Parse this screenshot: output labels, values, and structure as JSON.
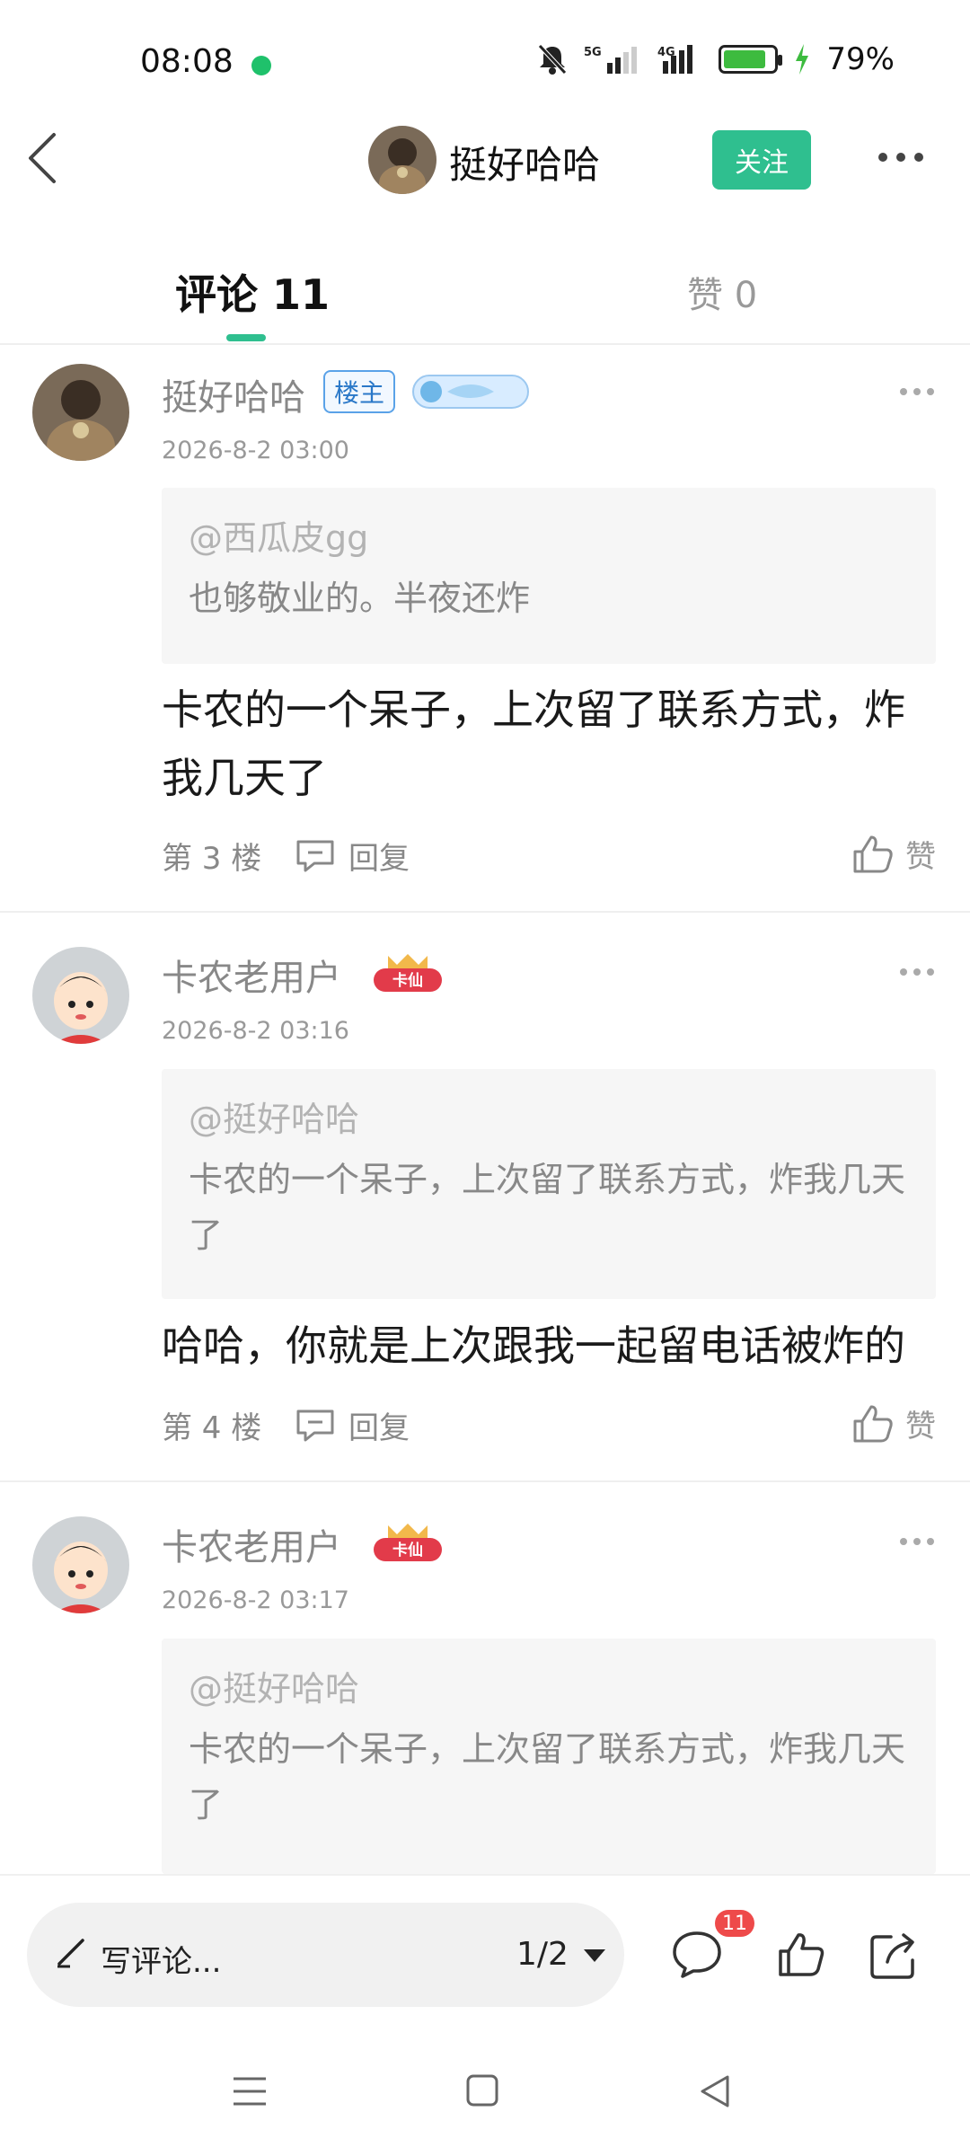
{
  "status_bar": {
    "time": "08:08",
    "battery_percent": "79%",
    "battery_level": 0.79,
    "network": "5G 4G"
  },
  "header": {
    "back_icon": "chevron-left-icon",
    "user_name": "挺好哈哈",
    "follow_label": "关注",
    "more_icon": "more-horizontal-icon"
  },
  "tabs": [
    {
      "label": "评论 11",
      "active": true
    },
    {
      "label": "赞 0",
      "active": false
    }
  ],
  "comments": [
    {
      "user": "挺好哈哈",
      "host_badge": "楼主",
      "time": "2026-8-2 03:00",
      "quote_user": "@西瓜皮gg",
      "quote_text": "也够敬业的。半夜还炸",
      "text": "卡农的一个呆子，上次留了联系方式，炸我几天了",
      "floor": "第 3 楼",
      "reply_label": "回复",
      "like_label": "赞"
    },
    {
      "user": "卡农老用户",
      "level_badge": "卡仙",
      "time": "2026-8-2 03:16",
      "quote_user": "@挺好哈哈",
      "quote_text": "卡农的一个呆子，上次留了联系方式，炸我几天了",
      "text": "哈哈，你就是上次跟我一起留电话被炸的",
      "floor": "第 4 楼",
      "reply_label": "回复",
      "like_label": "赞"
    },
    {
      "user": "卡农老用户",
      "level_badge": "卡仙",
      "time": "2026-8-2 03:17",
      "quote_user": "@挺好哈哈",
      "quote_text": "卡农的一个呆子，上次留了联系方式，炸我几天了"
    }
  ],
  "bottom_bar": {
    "write_placeholder": "写评论...",
    "page_indicator": "1/2",
    "comment_count": "11"
  },
  "colors": {
    "accent": "#2fbf8f",
    "badge_red": "#ee4a4a"
  }
}
